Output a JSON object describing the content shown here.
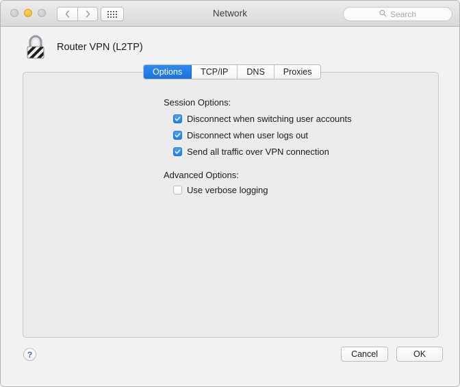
{
  "window": {
    "title": "Network",
    "traffic_lights": [
      {
        "name": "close",
        "color": "#c6c6c6"
      },
      {
        "name": "minimize",
        "color": "#f2b01e"
      },
      {
        "name": "zoom",
        "color": "#c6c6c6"
      }
    ],
    "nav": {
      "back_icon": "chevron-left-icon",
      "forward_icon": "chevron-right-icon"
    },
    "grid_button_icon": "grid-dots-icon",
    "search": {
      "placeholder": "Search",
      "value": "",
      "icon": "search-icon"
    }
  },
  "service": {
    "icon": "vpn-lock-icon",
    "name": "Router VPN (L2TP)"
  },
  "tabs": [
    {
      "label": "Options",
      "active": true
    },
    {
      "label": "TCP/IP",
      "active": false
    },
    {
      "label": "DNS",
      "active": false
    },
    {
      "label": "Proxies",
      "active": false
    }
  ],
  "sections": {
    "session": {
      "label": "Session Options:",
      "checkboxes": [
        {
          "label": "Disconnect when switching user accounts",
          "checked": true
        },
        {
          "label": "Disconnect when user logs out",
          "checked": true
        },
        {
          "label": "Send all traffic over VPN connection",
          "checked": true
        }
      ]
    },
    "advanced": {
      "label": "Advanced Options:",
      "checkboxes": [
        {
          "label": "Use verbose logging",
          "checked": false
        }
      ]
    }
  },
  "footer": {
    "help_label": "?",
    "cancel_label": "Cancel",
    "ok_label": "OK"
  },
  "colors": {
    "accent_blue": "#2481ea",
    "tab_active_blue": "#1a72df",
    "minimize_yellow": "#f2b01e",
    "panel_bg": "#ececec",
    "titlebar_bg": "#e4e4e4"
  }
}
